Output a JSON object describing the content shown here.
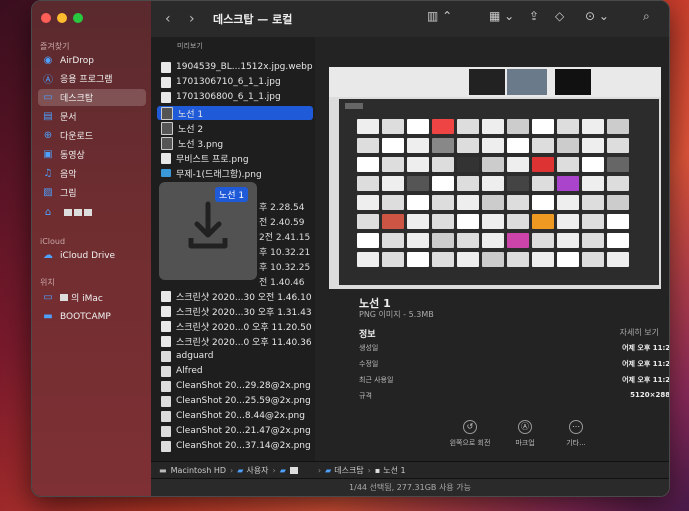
{
  "toolbar": {
    "title": "데스크탑 — 로컬",
    "back": "‹",
    "forward": "›"
  },
  "sidebar": {
    "favorites_header": "즐겨찾기",
    "icloud_header": "iCloud",
    "locations_header": "위치",
    "favorites": [
      {
        "label": "AirDrop",
        "icon": "airdrop-icon"
      },
      {
        "label": "응용 프로그램",
        "icon": "applications-icon"
      },
      {
        "label": "데스크탑",
        "icon": "desktop-icon"
      },
      {
        "label": "문서",
        "icon": "documents-icon"
      },
      {
        "label": "다운로드",
        "icon": "downloads-icon"
      },
      {
        "label": "동영상",
        "icon": "movies-icon"
      },
      {
        "label": "음악",
        "icon": "music-icon"
      },
      {
        "label": "그림",
        "icon": "pictures-icon"
      }
    ],
    "icloud": [
      {
        "label": "iCloud Drive",
        "icon": "cloud-icon"
      }
    ],
    "locations": [
      {
        "label": "의 iMac",
        "icon": "imac-icon"
      },
      {
        "label": "BOOTCAMP",
        "icon": "disk-icon"
      }
    ]
  },
  "list": {
    "header": "미리보기",
    "drag_label": "노선 1",
    "files": [
      {
        "name": "1904539_BL...1512x.jpg.webp",
        "kind": "image"
      },
      {
        "name": "1701306710_6_1_1.jpg",
        "kind": "image"
      },
      {
        "name": "1701306800_6_1_1.jpg",
        "kind": "image"
      },
      {
        "name": "노선 1",
        "kind": "dark"
      },
      {
        "name": "노선 2",
        "kind": "dark"
      },
      {
        "name": "노선 3.png",
        "kind": "dark"
      },
      {
        "name": "무비스트 프로.png",
        "kind": "image"
      },
      {
        "name": "무제-1(드래그함).png",
        "kind": "folder"
      }
    ],
    "times": [
      "후 2.28.54",
      "전 2.40.59",
      "2전 2.41.15",
      "후 10.32.21",
      "후 10.32.25",
      "전 1.40.46"
    ],
    "files2": [
      {
        "name": "스크린샷 2020...30 오전 1.46.10",
        "kind": "image"
      },
      {
        "name": "스크린샷 2020...30 오후 1.31.43",
        "kind": "image"
      },
      {
        "name": "스크린샷 2020...0 오후 11.20.50",
        "kind": "image"
      },
      {
        "name": "스크린샷 2020...0 오후 11.40.36",
        "kind": "image"
      },
      {
        "name": "adguard",
        "kind": "doc"
      },
      {
        "name": "Alfred",
        "kind": "doc"
      },
      {
        "name": "CleanShot 20...29.28@2x.png",
        "kind": "doc"
      },
      {
        "name": "CleanShot 20...25.59@2x.png",
        "kind": "doc"
      },
      {
        "name": "CleanShot 20...8.44@2x.png",
        "kind": "doc"
      },
      {
        "name": "CleanShot 20...21.47@2x.png",
        "kind": "doc"
      },
      {
        "name": "CleanShot 20...37.14@2x.png",
        "kind": "doc"
      }
    ]
  },
  "preview": {
    "title": "노선 1",
    "subtitle": "PNG 이미지 - 5.3MB",
    "info_header": "정보",
    "more": "자세히 보기",
    "rows": [
      {
        "k": "생성일",
        "v": "어제 오후 11:29"
      },
      {
        "k": "수정일",
        "v": "어제 오후 11:29"
      },
      {
        "k": "최근 사용일",
        "v": "어제 오후 11:29"
      },
      {
        "k": "규격",
        "v": "5120×2880"
      }
    ],
    "actions": [
      {
        "label": "왼쪽으로 회전",
        "icon": "rotate-icon"
      },
      {
        "label": "마크업",
        "icon": "markup-icon"
      },
      {
        "label": "기타...",
        "icon": "more-icon"
      }
    ]
  },
  "pathbar": {
    "disk": "Macintosh HD",
    "users": "사용자",
    "desktop": "데스크탑",
    "file": "노선 1"
  },
  "status": "1/44 선택됨, 277.31GB 사용 가능"
}
